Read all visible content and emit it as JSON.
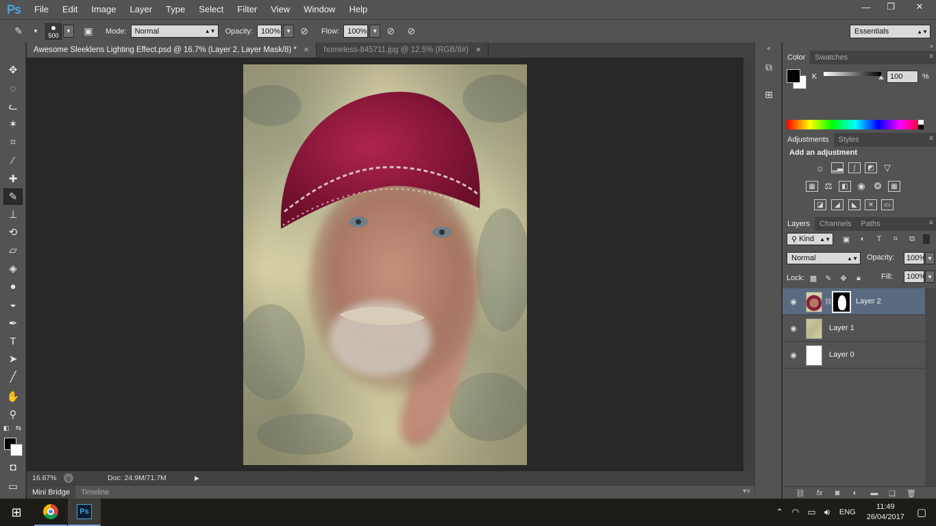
{
  "app": {
    "logo": "Ps",
    "menu": [
      "File",
      "Edit",
      "Image",
      "Layer",
      "Type",
      "Select",
      "Filter",
      "View",
      "Window",
      "Help"
    ],
    "window_controls": {
      "minimize": "—",
      "restore": "❐",
      "close": "✕"
    }
  },
  "options": {
    "brush_size": "500",
    "mode_label": "Mode:",
    "mode_value": "Normal",
    "opacity_label": "Opacity:",
    "opacity_value": "100%",
    "flow_label": "Flow:",
    "flow_value": "100%",
    "workspace": "Essentials"
  },
  "tabs": [
    {
      "title": "Awesome Sleeklens Lighting Effect.psd @ 16.7% (Layer 2, Layer Mask/8) *",
      "close": "✕"
    },
    {
      "title": "homeless-845711.jpg @ 12.5% (RGB/8#)",
      "close": "✕"
    }
  ],
  "status": {
    "zoom": "16.67%",
    "doc": "Doc: 24.9M/71.7M"
  },
  "bottom_tabs": [
    "Mini Bridge",
    "Timeline"
  ],
  "color_panel": {
    "tabs": [
      "Color",
      "Swatches"
    ],
    "channel": "K",
    "value": "100",
    "unit": "%",
    "k_level": 1.0
  },
  "adjustments": {
    "tabs": [
      "Adjustments",
      "Styles"
    ],
    "title": "Add an adjustment"
  },
  "layers": {
    "tabs": [
      "Layers",
      "Channels",
      "Paths"
    ],
    "filter_kind": "Kind",
    "blend_mode": "Normal",
    "opacity_label": "Opacity:",
    "opacity_value": "100%",
    "lock_label": "Lock:",
    "fill_label": "Fill:",
    "fill_value": "100%",
    "items": [
      {
        "name": "Layer 2",
        "selected": true
      },
      {
        "name": "Layer 1",
        "selected": false
      },
      {
        "name": "Layer 0",
        "selected": false
      }
    ]
  },
  "taskbar": {
    "lang": "ENG",
    "time": "11:49",
    "date": "26/04/2017"
  },
  "colors": {
    "selected_layer": "#596a80",
    "panel_bg": "#535353",
    "canvas_bg": "#282828"
  }
}
